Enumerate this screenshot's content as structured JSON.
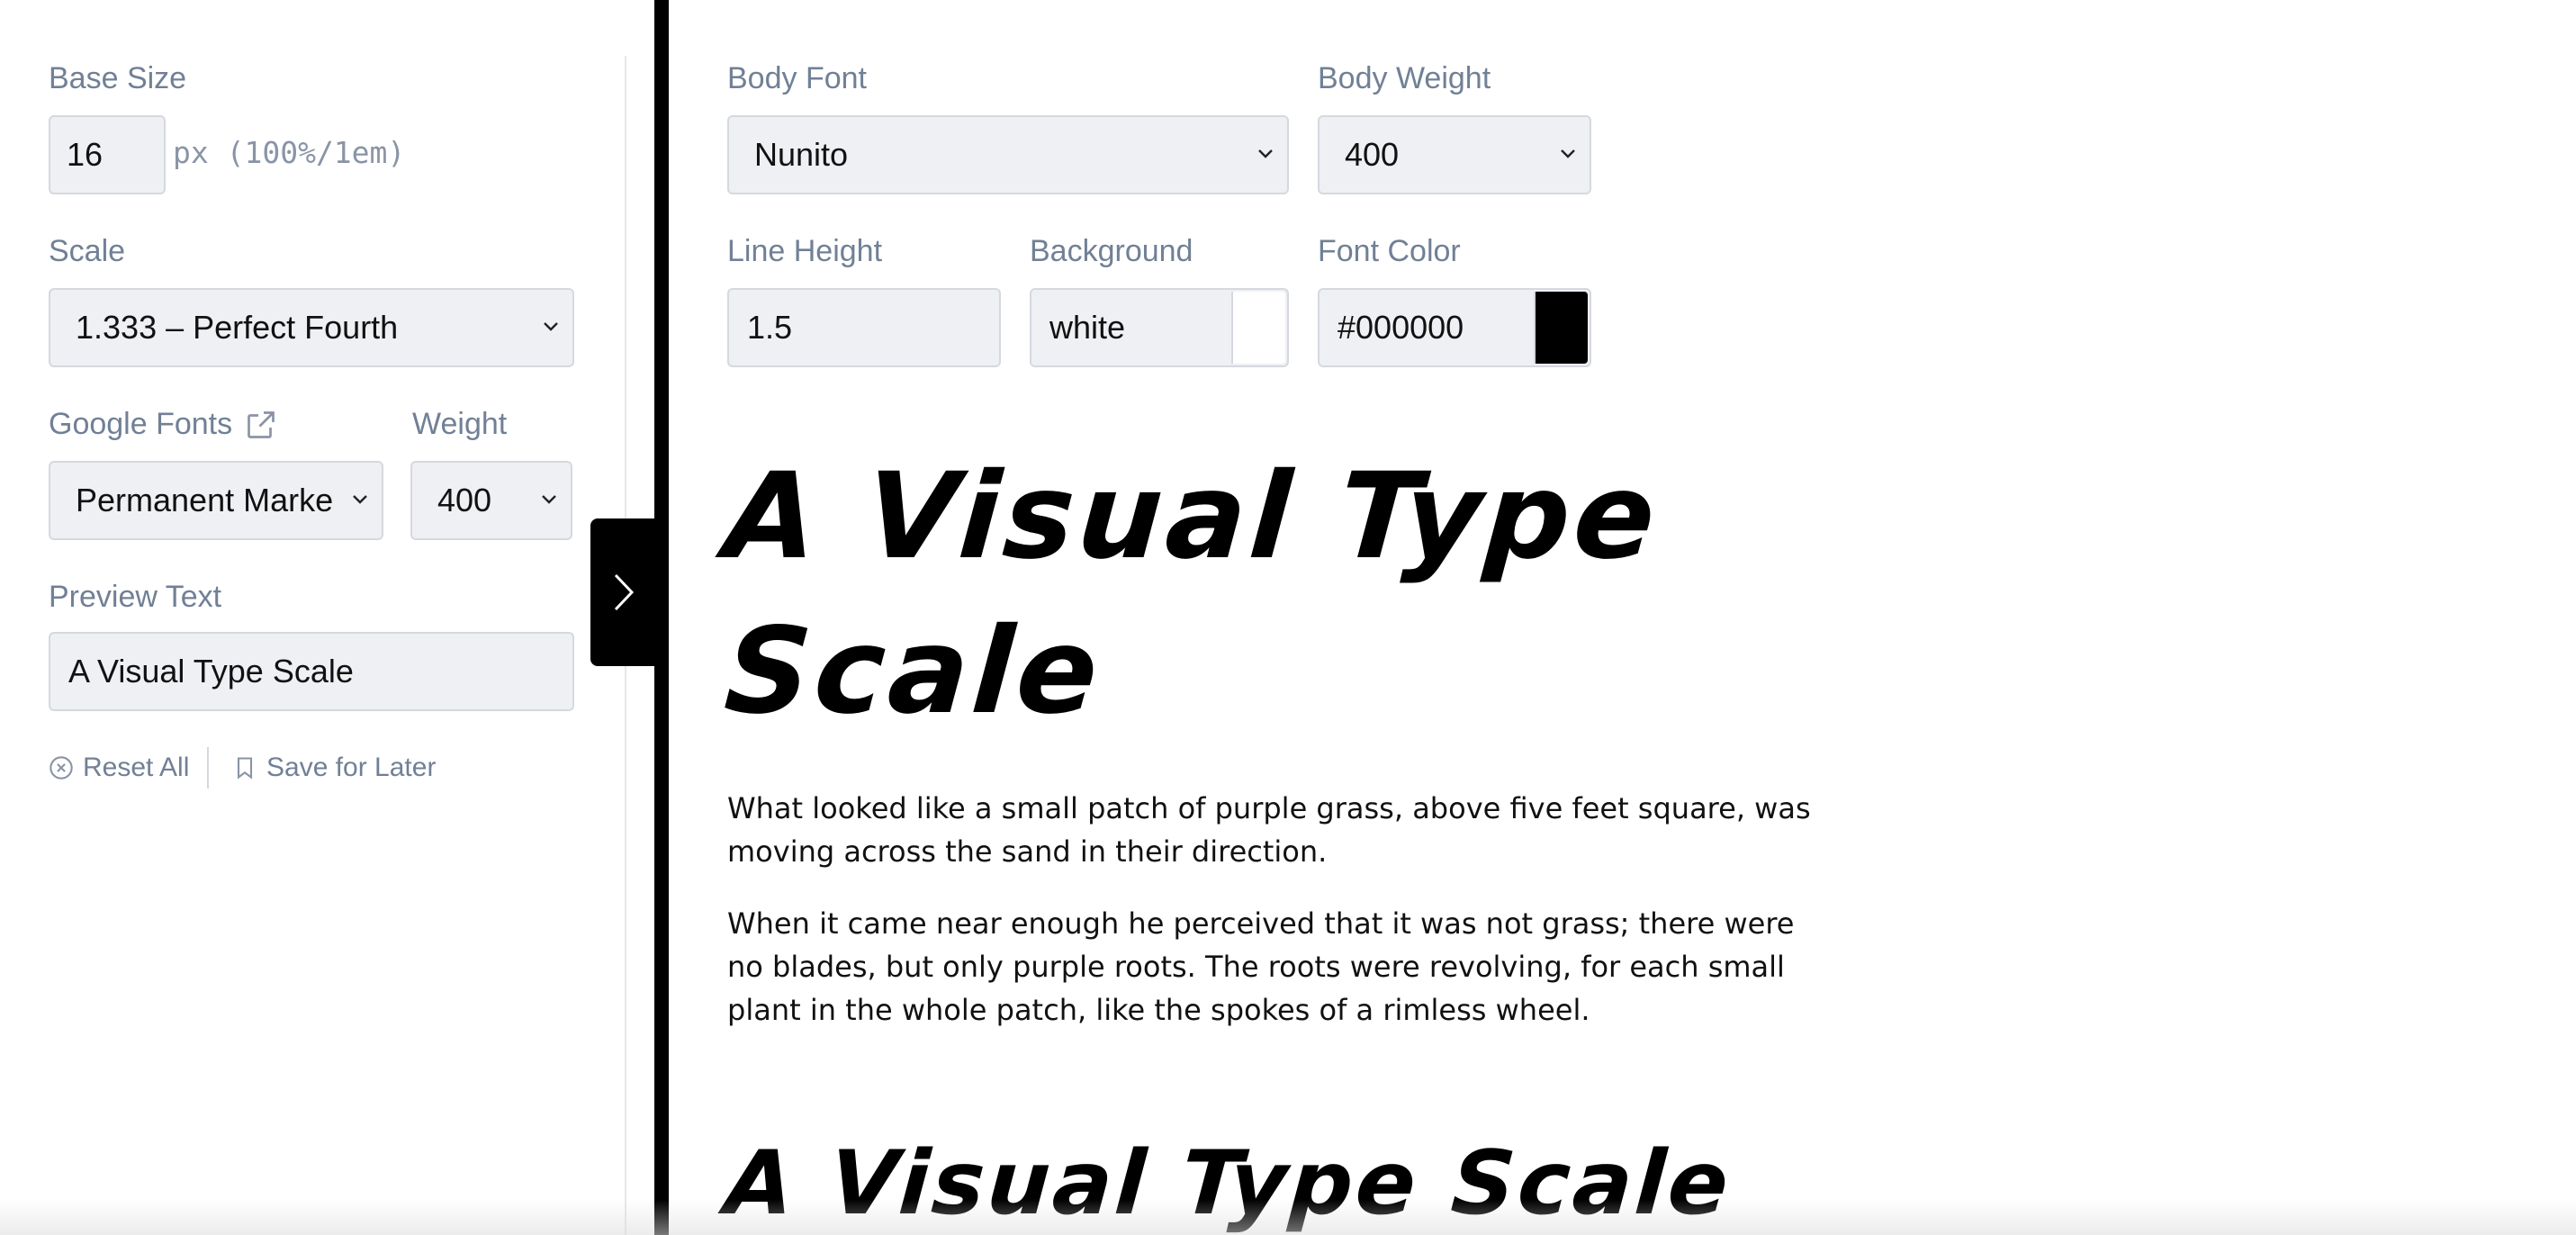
{
  "sidebar": {
    "base_size": {
      "label": "Base Size",
      "value": "16",
      "unit": "px (100%/1em)"
    },
    "scale": {
      "label": "Scale",
      "selected": "1.333 – Perfect Fourth"
    },
    "google_fonts": {
      "label": "Google Fonts",
      "selected": "Permanent Marke"
    },
    "weight": {
      "label": "Weight",
      "selected": "400"
    },
    "preview_text": {
      "label": "Preview Text",
      "value": "A Visual Type Scale"
    },
    "actions": {
      "reset": "Reset All",
      "save": "Save for Later"
    }
  },
  "controls": {
    "body_font": {
      "label": "Body Font",
      "selected": "Nunito"
    },
    "body_weight": {
      "label": "Body Weight",
      "selected": "400"
    },
    "line_height": {
      "label": "Line Height",
      "value": "1.5"
    },
    "background": {
      "label": "Background",
      "value": "white",
      "swatch": "#ffffff"
    },
    "font_color": {
      "label": "Font Color",
      "value": "#000000",
      "swatch": "#000000"
    }
  },
  "preview": {
    "heading_line1": "A Visual Type",
    "heading_line2": "Scale",
    "paragraph1": "What looked like a small patch of purple grass, above five feet square, was moving across the sand in their direction.",
    "paragraph2": "When it came near enough he perceived that it was not grass; there were no blades, but only purple roots. The roots were revolving, for each small plant in the whole patch, like the spokes of a rimless wheel.",
    "heading2": "A Visual Type Scale"
  },
  "colors": {
    "label": "#718096",
    "field_bg": "#eef0f3",
    "accent": "#000000"
  }
}
